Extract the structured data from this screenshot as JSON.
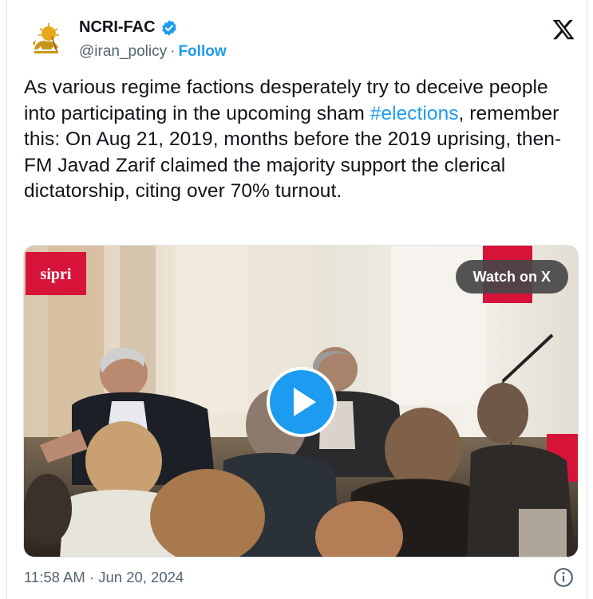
{
  "author": {
    "display_name": "NCRI-FAC",
    "handle": "@iran_policy",
    "separator": "·",
    "follow_label": "Follow"
  },
  "tweet": {
    "text_before_hashtag": "As various regime factions desperately try to deceive people into participating in the upcoming sham ",
    "hashtag": "#elections",
    "text_after_hashtag": ", remember this: On Aug 21, 2019, months before the 2019 uprising, then-FM Javad Zarif claimed the majority support the clerical dictatorship, citing over 70% turnout."
  },
  "media": {
    "watch_label": "Watch on X",
    "banner_text": "sipri"
  },
  "footer": {
    "timestamp": "11:58 AM · Jun 20, 2024"
  },
  "colors": {
    "accent": "#1d9bf0",
    "text": "#0f1419",
    "muted": "#536471",
    "sipri_red": "#d6143a"
  },
  "icons": [
    "verified-badge-icon",
    "x-logo-icon",
    "play-icon",
    "info-icon"
  ]
}
